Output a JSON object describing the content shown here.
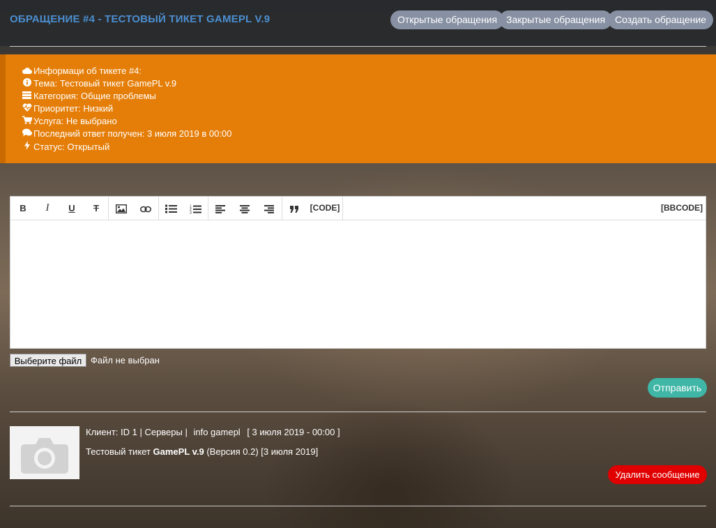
{
  "header": {
    "title": "ОБРАЩЕНИЕ #4 - ТЕСТОВЫЙ ТИКЕТ GAMEPL V.9",
    "buttons": {
      "open": "Открытые обращения",
      "closed": "Закрытые обращения",
      "create": "Создать обращение"
    }
  },
  "info": {
    "heading": "Информаци об тикете #4:",
    "topic": "Тема: Тестовый тикет GamePL v.9",
    "category": "Категория: Общие проблемы",
    "priority": "Приоритет: Низкий",
    "service": "Услуга: Не выбрано",
    "last_reply": "Последний ответ получен: 3 июля 2019 в 00:00",
    "status": "Статус: Открытый",
    "panel_color": "#e57e08"
  },
  "editor": {
    "toolbar": {
      "bold": "B",
      "italic": "I",
      "underline": "U",
      "strike": "T",
      "code": "[CODE]",
      "bbcode": "[BBCODE]"
    },
    "text": ""
  },
  "file": {
    "button": "Выберите файл",
    "status": "Файл не выбран"
  },
  "send_button": "Отправить",
  "message": {
    "client_label": "Клиент: ID 1 | Серверы |",
    "username": "info gamepl",
    "date": "[ 3 июля 2019 - 00:00 ]",
    "body_prefix": "Тестовый тикет",
    "body_bold": "GamePL v.9",
    "body_suffix": "(Версия 0.2) [3 июля 2019]",
    "delete_button": "Удалить сообщение"
  }
}
